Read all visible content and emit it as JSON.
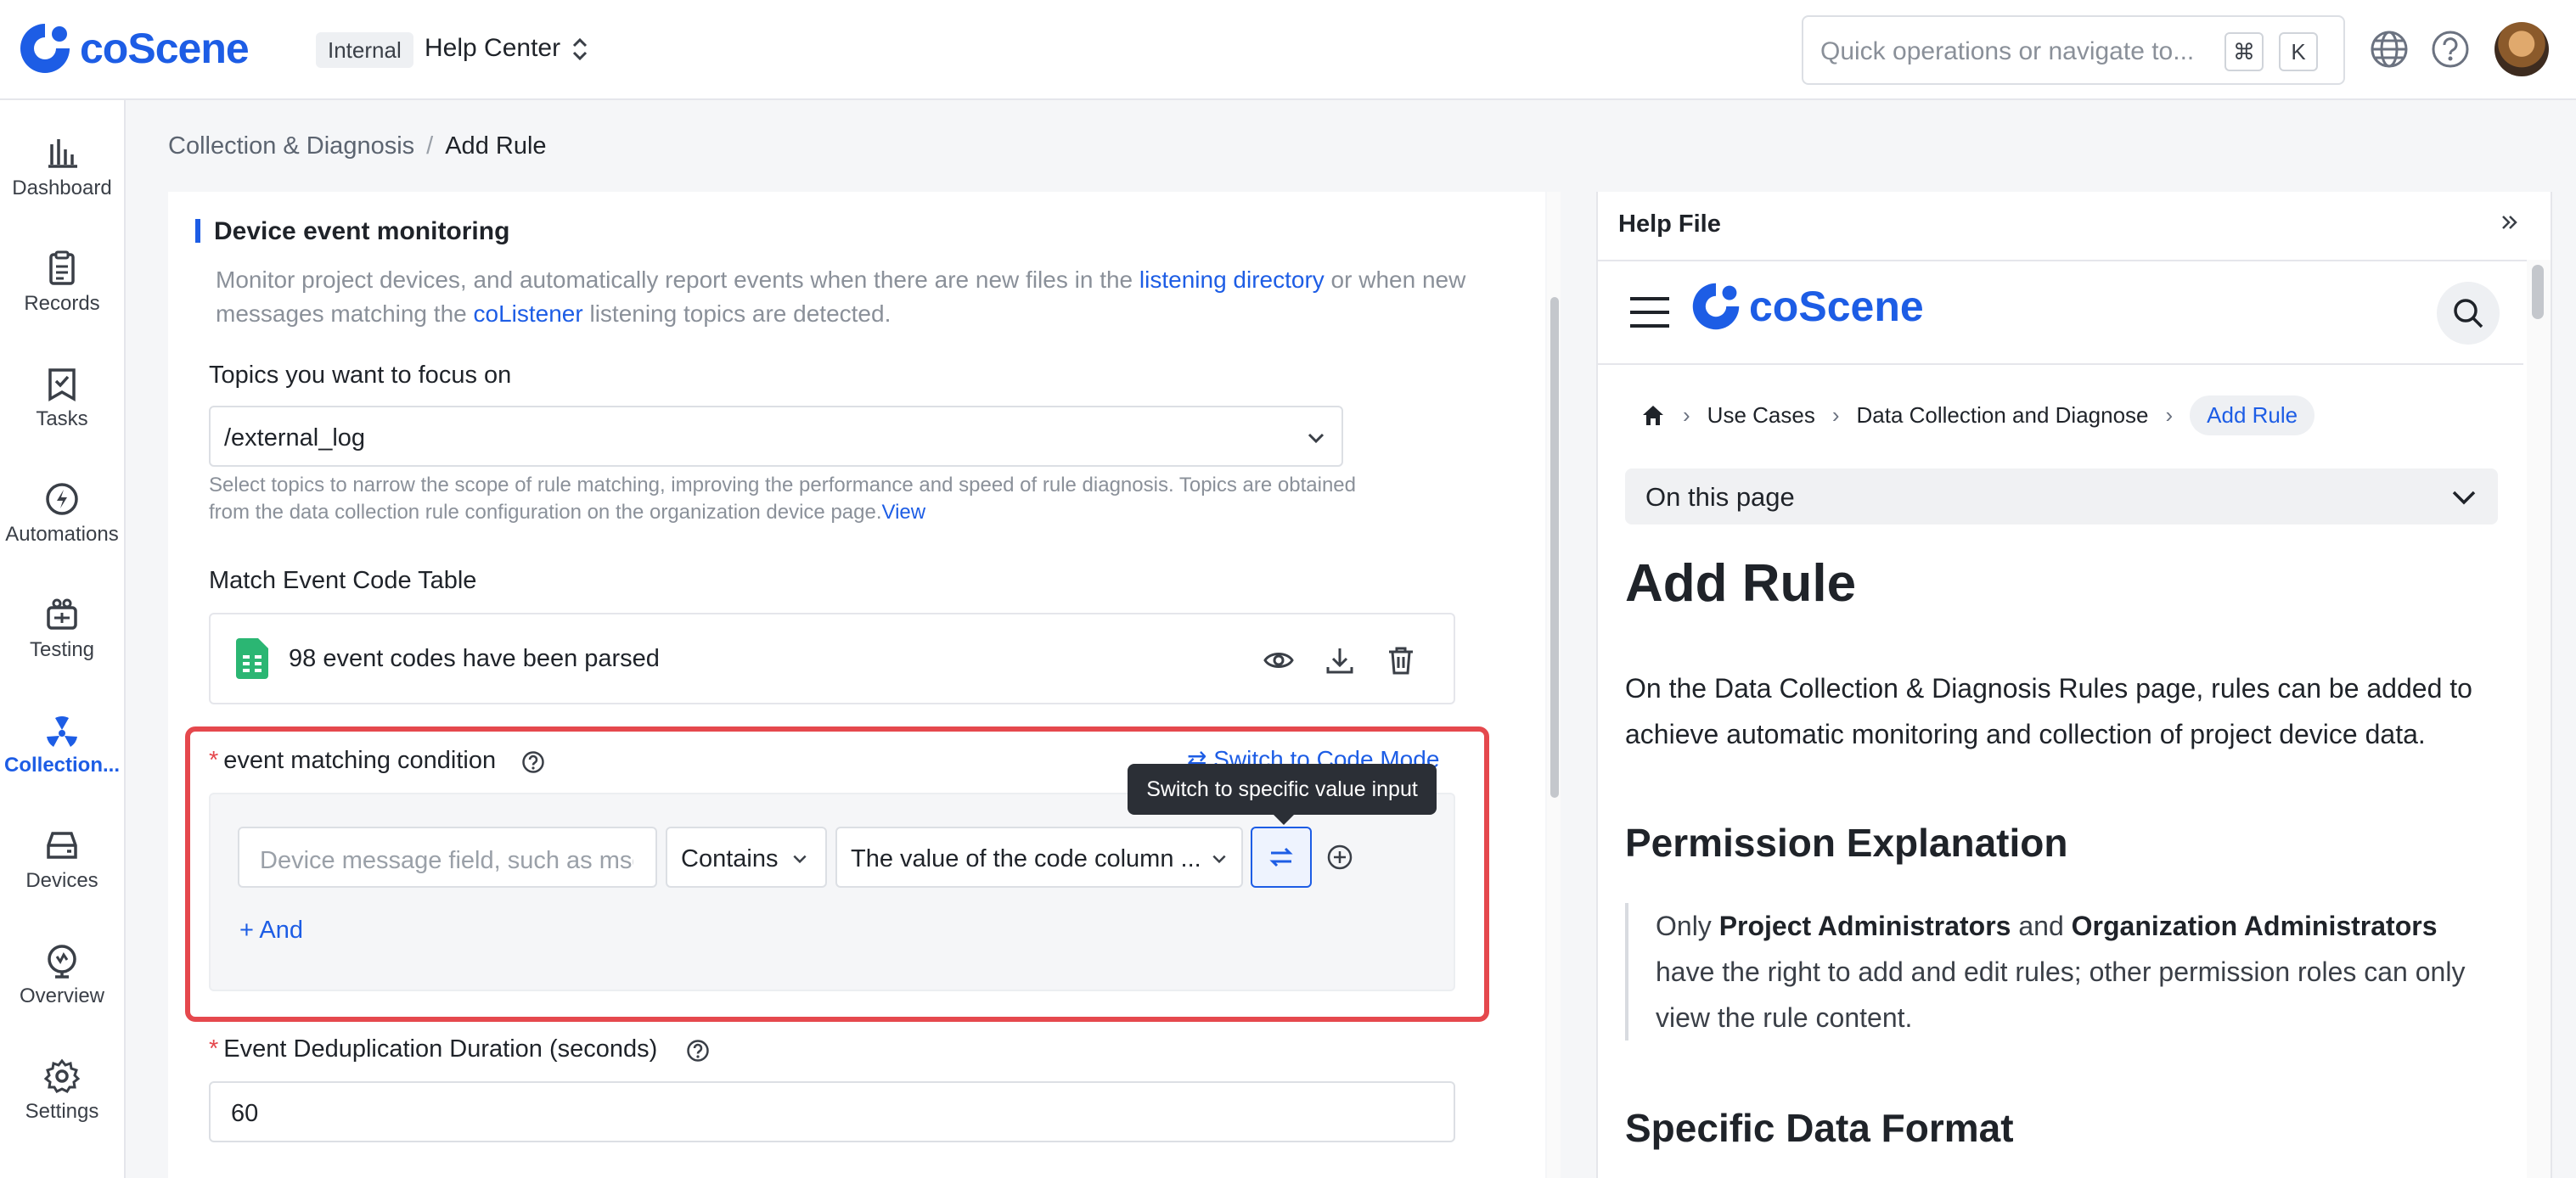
{
  "header": {
    "brand": "coScene",
    "project_badge": "Internal",
    "project_name": "Help Center",
    "search_placeholder": "Quick operations or navigate to...",
    "shortcut_cmd": "⌘",
    "shortcut_key": "K"
  },
  "sidebar": {
    "items": [
      {
        "label": "Dashboard"
      },
      {
        "label": "Records"
      },
      {
        "label": "Tasks"
      },
      {
        "label": "Automations"
      },
      {
        "label": "Testing"
      },
      {
        "label": "Collection..."
      },
      {
        "label": "Devices"
      },
      {
        "label": "Overview"
      },
      {
        "label": "Settings"
      }
    ],
    "active_index": 5
  },
  "breadcrumb": {
    "parent": "Collection & Diagnosis",
    "separator": "/",
    "current": "Add Rule"
  },
  "form": {
    "section_title": "Device event monitoring",
    "desc_part1": "Monitor project devices, and automatically report events when there are new files in the ",
    "desc_link1": "listening directory",
    "desc_part2": " or when new messages matching the ",
    "desc_link2": "coListener",
    "desc_part3": " listening topics are detected.",
    "topics_label": "Topics you want to focus on",
    "topics_value": "/external_log",
    "topics_hint": "Select topics to narrow the scope of rule matching, improving the performance and speed of rule diagnosis. Topics are obtained from the data collection rule configuration on the organization device page.",
    "topics_hint_link": "View",
    "event_table_label": "Match Event Code Table",
    "event_table_file": "98 event codes have been parsed",
    "condition_label": "event matching condition",
    "switch_code_mode": "Switch to Code Mode",
    "field_placeholder": "Device message field, such as msg",
    "operator_value": "Contains",
    "value_select": "The value of the code column ...",
    "tooltip": "Switch to specific value input",
    "and_label": "And",
    "dedup_label": "Event Deduplication Duration (seconds)",
    "dedup_value": "60",
    "required_mark": "*"
  },
  "help": {
    "panel_title": "Help File",
    "doc_brand": "coScene",
    "doc_crumbs": [
      "Use Cases",
      "Data Collection and Diagnose",
      "Add Rule"
    ],
    "on_this_page": "On this page",
    "h1": "Add Rule",
    "intro": "On the Data Collection & Diagnosis Rules page, rules can be added to achieve automatic monitoring and collection of project device data.",
    "h2_permission": "Permission Explanation",
    "quote_pre": "Only ",
    "quote_bold1": "Project Administrators",
    "quote_mid": " and ",
    "quote_bold2": "Organization Administrators",
    "quote_post": " have the right to add and edit rules; other permission roles can only view the rule content.",
    "h2_format": "Specific Data Format"
  },
  "colors": {
    "accent": "#1d5de5",
    "highlight_border": "#e5484d"
  }
}
